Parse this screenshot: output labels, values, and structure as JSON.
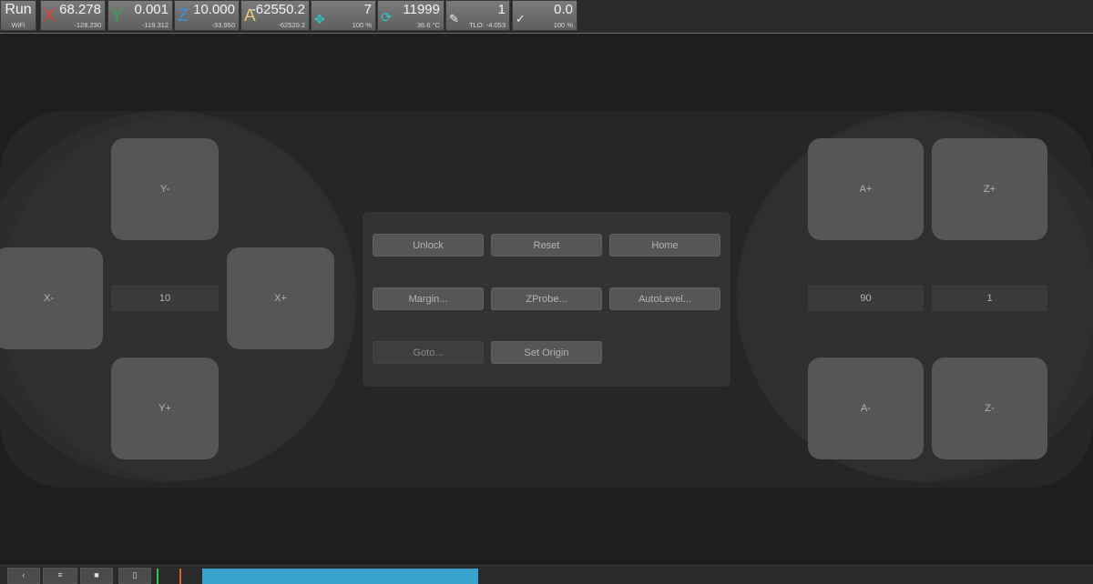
{
  "status": {
    "state": "Run",
    "connection": "WiFi",
    "axes": [
      {
        "letter": "X",
        "color": "#e03c31",
        "work": "68.278",
        "machine": "-128.230"
      },
      {
        "letter": "Y",
        "color": "#2ea84a",
        "work": "0.001",
        "machine": "-119.312"
      },
      {
        "letter": "Z",
        "color": "#3f8fd8",
        "work": "10.000",
        "machine": "-33.950"
      },
      {
        "letter": "A",
        "color": "#e8c77a",
        "work": "-62550.2",
        "machine": "-62520.2"
      }
    ],
    "feed": {
      "icon": "crosshair-move-icon",
      "value": "7",
      "percent": "100 %"
    },
    "spindle": {
      "icon": "spindle-rotate-icon",
      "value": "11999",
      "temp": "36.6 °C"
    },
    "tool": {
      "icon": "tool-change-icon",
      "value": "1",
      "tlo": "TLO: -4.053"
    },
    "laser": {
      "icon": "laser-pen-icon",
      "value": "0.0",
      "percent": "100 %"
    }
  },
  "jog_left": {
    "y_minus": "Y-",
    "x_minus": "X-",
    "x_plus": "X+",
    "y_plus": "Y+",
    "step": "10"
  },
  "jog_right": {
    "a_plus": "A+",
    "z_plus": "Z+",
    "a_minus": "A-",
    "z_minus": "Z-",
    "a_step": "90",
    "z_step": "1"
  },
  "commands": {
    "unlock": "Unlock",
    "reset": "Reset",
    "home": "Home",
    "margin": "Margin...",
    "zprobe": "ZProbe...",
    "autolevel": "AutoLevel...",
    "goto": "Goto...",
    "set_origin": "Set Origin"
  },
  "bottom": {
    "menu_icon": "menu-icon",
    "progress_color": "#38a3cc"
  }
}
